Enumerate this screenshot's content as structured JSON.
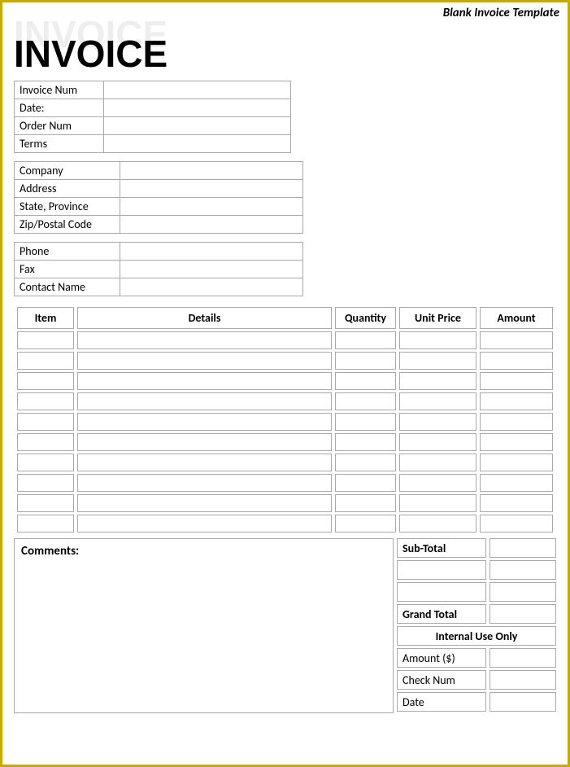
{
  "header": {
    "label": "Blank Invoice Template"
  },
  "title": {
    "ghost": "INVOICE",
    "main": "INVOICE"
  },
  "meta": {
    "rows": [
      {
        "label": "Invoice Num",
        "value": ""
      },
      {
        "label": "Date:",
        "value": ""
      },
      {
        "label": "Order Num",
        "value": ""
      },
      {
        "label": "Terms",
        "value": ""
      }
    ]
  },
  "company": {
    "rows": [
      {
        "label": "Company",
        "value": ""
      },
      {
        "label": "Address",
        "value": ""
      },
      {
        "label": "State, Province",
        "value": ""
      },
      {
        "label": "Zip/Postal Code",
        "value": ""
      }
    ]
  },
  "contact": {
    "rows": [
      {
        "label": "Phone",
        "value": ""
      },
      {
        "label": "Fax",
        "value": ""
      },
      {
        "label": "Contact Name",
        "value": ""
      }
    ]
  },
  "items": {
    "headers": {
      "item": "Item",
      "details": "Details",
      "qty": "Quantity",
      "price": "Unit Price",
      "amount": "Amount"
    },
    "rows": [
      {
        "item": "",
        "details": "",
        "qty": "",
        "price": "",
        "amount": ""
      },
      {
        "item": "",
        "details": "",
        "qty": "",
        "price": "",
        "amount": ""
      },
      {
        "item": "",
        "details": "",
        "qty": "",
        "price": "",
        "amount": ""
      },
      {
        "item": "",
        "details": "",
        "qty": "",
        "price": "",
        "amount": ""
      },
      {
        "item": "",
        "details": "",
        "qty": "",
        "price": "",
        "amount": ""
      },
      {
        "item": "",
        "details": "",
        "qty": "",
        "price": "",
        "amount": ""
      },
      {
        "item": "",
        "details": "",
        "qty": "",
        "price": "",
        "amount": ""
      },
      {
        "item": "",
        "details": "",
        "qty": "",
        "price": "",
        "amount": ""
      },
      {
        "item": "",
        "details": "",
        "qty": "",
        "price": "",
        "amount": ""
      },
      {
        "item": "",
        "details": "",
        "qty": "",
        "price": "",
        "amount": ""
      }
    ]
  },
  "comments": {
    "label": "Comments:"
  },
  "totals": {
    "subtotal_label": "Sub-Total",
    "subtotal_value": "",
    "blank1": "",
    "blank1v": "",
    "blank2": "",
    "blank2v": "",
    "grand_label": "Grand Total",
    "grand_value": "",
    "internal_header": "Internal Use Only",
    "amount_label": "Amount ($)",
    "amount_value": "",
    "check_label": "Check Num",
    "check_value": "",
    "date_label": "Date",
    "date_value": ""
  }
}
